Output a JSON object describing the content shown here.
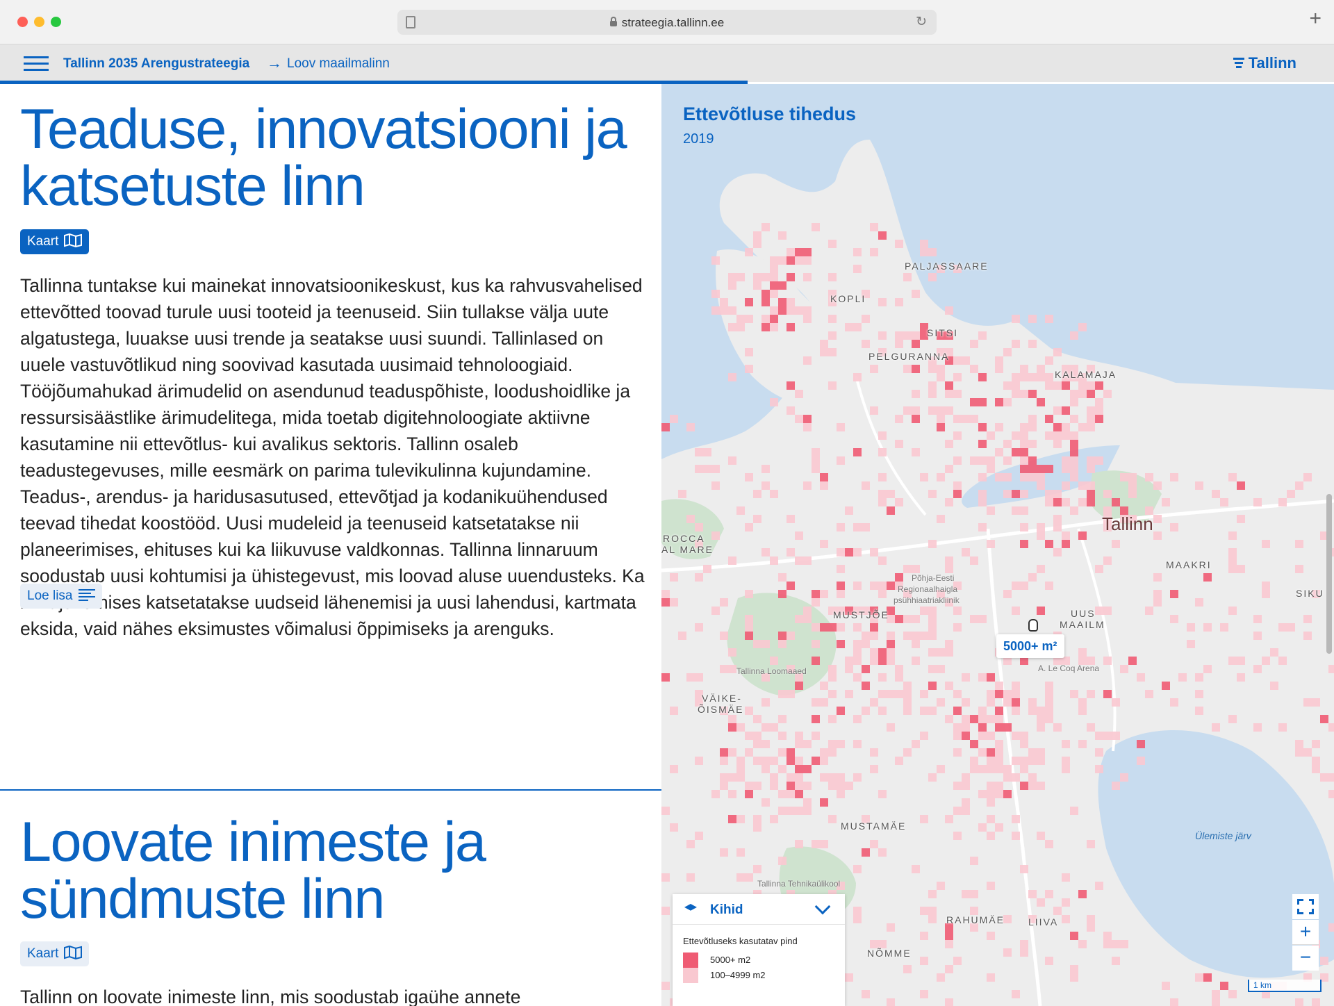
{
  "browser": {
    "url": "strateegia.tallinn.ee"
  },
  "header": {
    "breadcrumb_root": "Tallinn 2035 Arengustrateegia",
    "breadcrumb_separator": "→",
    "breadcrumb_current": "Loov maailmalinn",
    "brand": "Tallinn"
  },
  "sections": [
    {
      "title": "Teaduse, innovatsiooni ja katsetuste linn",
      "map_button": "Kaart",
      "body": "Tallinna tuntakse kui mainekat innovatsioonikeskust, kus ka rahvusvahelised ettevõtted toovad turule uusi tooteid ja teenuseid. Siin tullakse välja uute algatustega, luuakse uusi trende ja seatakse uusi suundi. Tallinlased on uuele vastuvõtlikud ning soovivad kasutada uusimaid tehnoloogiaid. Tööjõumahukad ärimudelid on asendunud teaduspõhiste, loodushoidlike ja ressursisäästlike ärimudelitega, mida toetab digitehnoloogiate aktiivne kasutamine nii ettevõtlus- kui avalikus sektoris. Tallinn osaleb teadustegevuses, mille eesmärk on parima tulevikulinna kujundamine. Teadus-, arendus- ja haridusasutused, ettevõtjad ja kodanikuühendused teevad tihedat koostööd. Uusi mudeleid ja teenuseid katsetatakse nii planeerimises, ehituses kui ka liikuvuse valdkonnas. Tallinna linnaruum soodustab uusi kohtumisi ja ühistegevust, mis loovad aluse uuendusteks. Ka linnajuhtimises katsetatakse uudseid lähenemisi ja uusi lahendusi, kartmata eksida, vaid nähes eksimustes võimalusi õppimiseks ja arenguks.",
      "read_more": "Loe lisa"
    },
    {
      "title": "Loovate inimeste ja sündmuste linn",
      "map_button": "Kaart",
      "body": "Tallinn on loovate inimeste linn, mis soodustab igaühe annete"
    }
  ],
  "map": {
    "title": "Ettevõtluse tihedus",
    "year": "2019",
    "city_label": "Tallinn",
    "place_labels": [
      "PALJASSAARE",
      "KOPLI",
      "SITSI",
      "PELGURANNA",
      "KALAMAJA",
      "ROCCA",
      "AL MARE",
      "MAAKRI",
      "SIKU",
      "MUSTJÕE",
      "UUS",
      "MAAILM",
      "VÄIKE-",
      "ÕISMÄE",
      "MUSTAMÄE",
      "RAHUMÄE",
      "LIIVA",
      "NÕMME"
    ],
    "poi_labels": [
      "Põhja-Eesti",
      "Regionaalhaigla",
      "psühhiaatriakliinik",
      "Tallinna Loomaaed",
      "A. Le Coq Arena",
      "Tallinna Tehnikaülikool"
    ],
    "lake_label": "Ülemiste järv",
    "tooltip": "5000+ m²",
    "layers_label": "Kihid",
    "legend_title": "Ettevõtluseks kasutatav pind",
    "legend_items": [
      {
        "label": "5000+ m2",
        "color": "#ef5b73"
      },
      {
        "label": "100–4999 m2",
        "color": "#f9c8d0"
      }
    ],
    "zoom_in": "+",
    "zoom_out": "−",
    "scale_label": "1 km"
  },
  "colors": {
    "accent": "#0a63c1",
    "water": "#c8dcef",
    "land": "#ededed",
    "park": "#cfe3cf",
    "density_high": "#ef5b73",
    "density_low": "#f9c8d0"
  }
}
